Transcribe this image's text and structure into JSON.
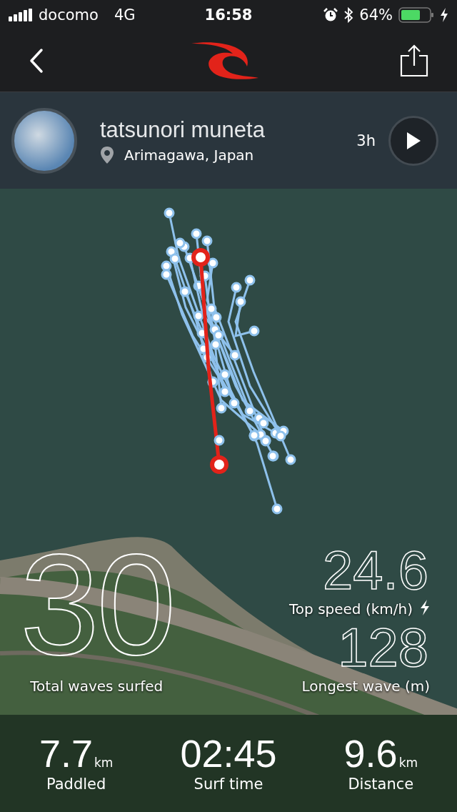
{
  "status_bar": {
    "carrier": "docomo",
    "network": "4G",
    "time": "16:58",
    "battery": "64%"
  },
  "profile": {
    "name": "tatsunori muneta",
    "location": "Arimagawa, Japan",
    "duration": "3h"
  },
  "highlights": [
    {
      "kind": "main",
      "value": "30",
      "label": "Total waves surfed"
    },
    {
      "kind": "speed",
      "value": "24.6",
      "label": "Top speed (km/h)"
    },
    {
      "kind": "plain",
      "value": "128",
      "label": "Longest wave (m)"
    }
  ],
  "summary": [
    {
      "value": "7.7",
      "unit": "km",
      "label": "Paddled"
    },
    {
      "value": "02:45",
      "label": "Surf time"
    },
    {
      "value": "9.6",
      "unit": "km",
      "label": "Distance"
    }
  ]
}
